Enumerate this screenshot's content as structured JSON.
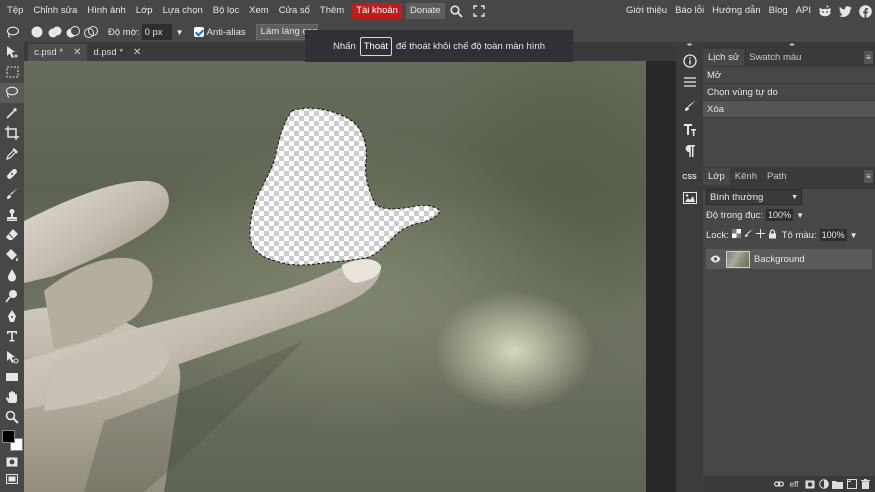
{
  "menu": {
    "items": [
      "Tệp",
      "Chỉnh sửa",
      "Hình ảnh",
      "Lớp",
      "Lựa chọn",
      "Bộ lọc",
      "Xem",
      "Cửa sổ",
      "Thêm"
    ],
    "account": "Tài khoản",
    "donate": "Donate",
    "right_links": [
      "Giới thiệu",
      "Báo lỗi",
      "Hướng dẫn",
      "Blog",
      "API"
    ],
    "icons": [
      "search-icon",
      "fullscreen-icon",
      "reddit-icon",
      "twitter-icon",
      "facebook-icon"
    ]
  },
  "options": {
    "feather_label": "Độ mờ:",
    "feather_value": "0 px",
    "antialias_label": "Anti-alias",
    "antialias_checked": true,
    "refine_label": "Làm láng cạnh"
  },
  "notice": {
    "prefix": "Nhấn",
    "key": "Thoát",
    "suffix": "để thoát khỏi chế độ toàn màn hình"
  },
  "tabs": [
    {
      "name": "c.psd",
      "modified": "*",
      "close": "✕"
    },
    {
      "name": "d.psd",
      "modified": "*",
      "close": "✕"
    }
  ],
  "history": {
    "tabs": [
      "Lịch sử",
      "Swatch màu"
    ],
    "items": [
      "Mở",
      "Chọn vùng tự do",
      "Xóa"
    ]
  },
  "layers": {
    "tabs": [
      "Lớp",
      "Kênh",
      "Path"
    ],
    "blend_mode": "Bình thường",
    "opacity_label": "Độ trong đục:",
    "opacity_value": "100%",
    "lock_label": "Lock:",
    "fill_label": "Tô màu:",
    "fill_value": "100%",
    "layer_name": "Background",
    "footer_text": "eff"
  },
  "strip": {
    "css_label": "CSS"
  },
  "colors": {
    "foreground": "#000000",
    "background": "#ffffff",
    "account_red": "#c11c1c"
  }
}
